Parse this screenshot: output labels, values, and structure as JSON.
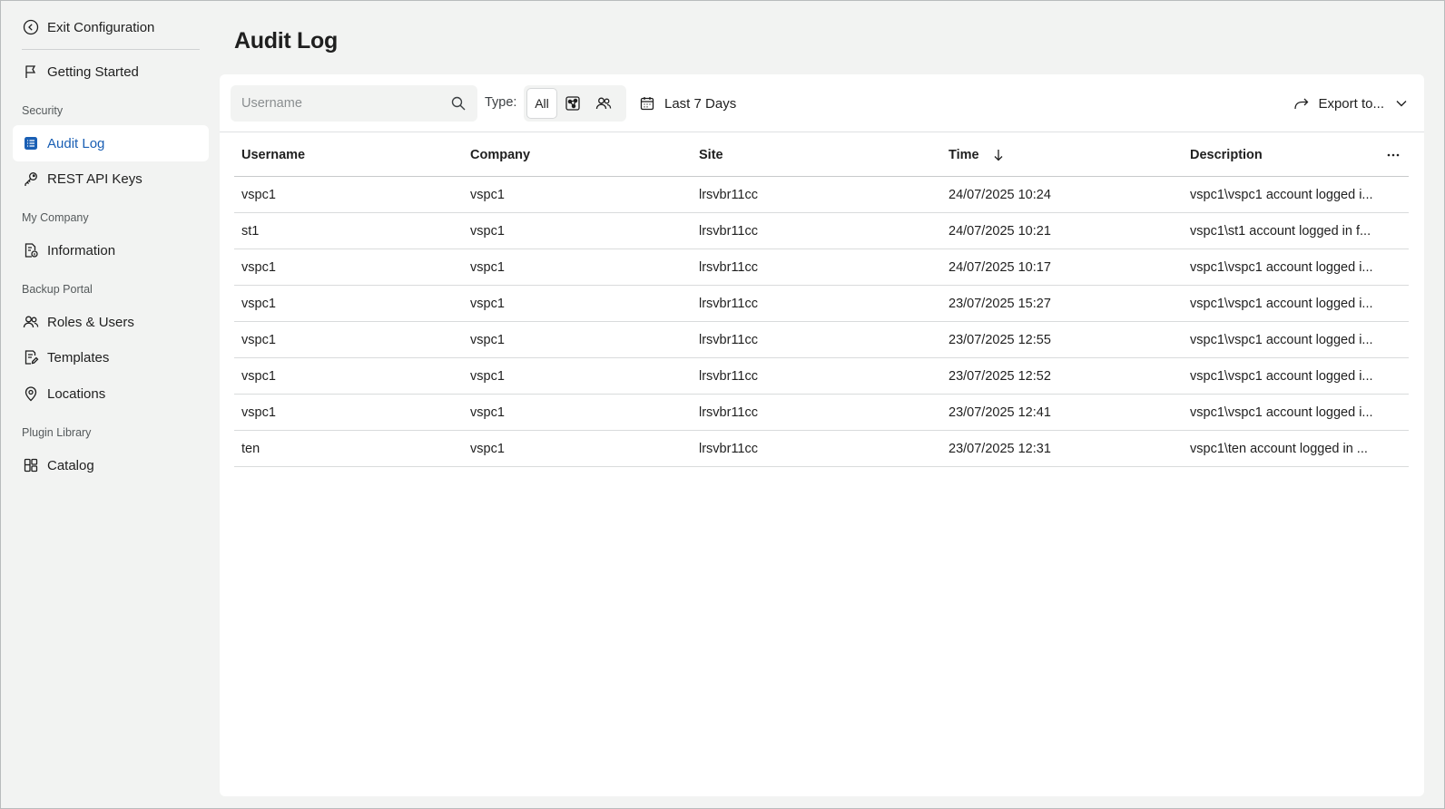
{
  "sidebar": {
    "exit": "Exit Configuration",
    "getting_started": "Getting Started",
    "sections": {
      "security": "Security",
      "my_company": "My Company",
      "backup_portal": "Backup Portal",
      "plugin_library": "Plugin Library"
    },
    "items": {
      "audit_log": "Audit Log",
      "rest_api_keys": "REST API Keys",
      "information": "Information",
      "roles_users": "Roles & Users",
      "templates": "Templates",
      "locations": "Locations",
      "catalog": "Catalog"
    },
    "active_color": "#1a5fb4"
  },
  "page": {
    "title": "Audit Log"
  },
  "toolbar": {
    "search_placeholder": "Username",
    "type_label": "Type:",
    "type_options": {
      "all": "All",
      "company_icon": "company-icon",
      "users_icon": "users-icon"
    },
    "type_selected": "All",
    "date_range": "Last 7 Days",
    "export_label": "Export to..."
  },
  "table": {
    "columns": [
      "Username",
      "Company",
      "Site",
      "Time",
      "Description"
    ],
    "sort_column": "Time",
    "sort_direction": "descending",
    "rows": [
      {
        "username": "vspc1",
        "company": "vspc1",
        "site": "lrsvbr11cc",
        "time": "24/07/2025 10:24",
        "description": "vspc1\\vspc1 account logged i..."
      },
      {
        "username": "st1",
        "company": "vspc1",
        "site": "lrsvbr11cc",
        "time": "24/07/2025 10:21",
        "description": "vspc1\\st1 account logged in f..."
      },
      {
        "username": "vspc1",
        "company": "vspc1",
        "site": "lrsvbr11cc",
        "time": "24/07/2025 10:17",
        "description": "vspc1\\vspc1 account logged i..."
      },
      {
        "username": "vspc1",
        "company": "vspc1",
        "site": "lrsvbr11cc",
        "time": "23/07/2025 15:27",
        "description": "vspc1\\vspc1 account logged i..."
      },
      {
        "username": "vspc1",
        "company": "vspc1",
        "site": "lrsvbr11cc",
        "time": "23/07/2025 12:55",
        "description": "vspc1\\vspc1 account logged i..."
      },
      {
        "username": "vspc1",
        "company": "vspc1",
        "site": "lrsvbr11cc",
        "time": "23/07/2025 12:52",
        "description": "vspc1\\vspc1 account logged i..."
      },
      {
        "username": "vspc1",
        "company": "vspc1",
        "site": "lrsvbr11cc",
        "time": "23/07/2025 12:41",
        "description": "vspc1\\vspc1 account logged i..."
      },
      {
        "username": "ten",
        "company": "vspc1",
        "site": "lrsvbr11cc",
        "time": "23/07/2025 12:31",
        "description": "vspc1\\ten account logged in ..."
      }
    ]
  }
}
